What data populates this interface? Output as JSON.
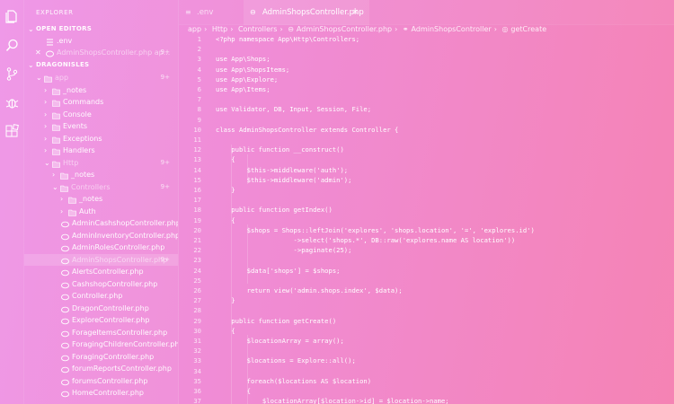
{
  "activity_bar": {
    "icons": [
      "files-icon",
      "search-icon",
      "source-control-icon",
      "debug-icon",
      "extensions-icon"
    ]
  },
  "explorer": {
    "title": "EXPLORER",
    "open_editors_label": "OPEN EDITORS",
    "open_editors": [
      {
        "name": ".env",
        "badge": ""
      },
      {
        "name": "AdminShopsController.php ap...",
        "badge": "9+"
      }
    ],
    "project_label": "DRAGONISLES",
    "tree": [
      {
        "name": "app",
        "type": "folder",
        "badge": "9+"
      },
      {
        "name": "_notes",
        "type": "folder",
        "badge": ""
      },
      {
        "name": "Commands",
        "type": "folder",
        "badge": ""
      },
      {
        "name": "Console",
        "type": "folder",
        "badge": ""
      },
      {
        "name": "Events",
        "type": "folder",
        "badge": ""
      },
      {
        "name": "Exceptions",
        "type": "folder",
        "badge": ""
      },
      {
        "name": "Handlers",
        "type": "folder",
        "badge": ""
      },
      {
        "name": "Http",
        "type": "folder",
        "badge": "9+"
      },
      {
        "name": "_notes",
        "type": "folder",
        "badge": ""
      },
      {
        "name": "Controllers",
        "type": "folder",
        "badge": "9+"
      },
      {
        "name": "_notes",
        "type": "folder",
        "badge": ""
      },
      {
        "name": "Auth",
        "type": "folder",
        "badge": ""
      },
      {
        "name": "AdminCashshopController.php",
        "type": "file",
        "badge": ""
      },
      {
        "name": "AdminInventoryController.php",
        "type": "file",
        "badge": ""
      },
      {
        "name": "AdminRolesController.php",
        "type": "file",
        "badge": ""
      },
      {
        "name": "AdminShopsController.php",
        "type": "file",
        "badge": "9+"
      },
      {
        "name": "AlertsController.php",
        "type": "file",
        "badge": ""
      },
      {
        "name": "CashshopController.php",
        "type": "file",
        "badge": ""
      },
      {
        "name": "Controller.php",
        "type": "file",
        "badge": ""
      },
      {
        "name": "DragonController.php",
        "type": "file",
        "badge": ""
      },
      {
        "name": "ExploreController.php",
        "type": "file",
        "badge": ""
      },
      {
        "name": "ForageItemsController.php",
        "type": "file",
        "badge": ""
      },
      {
        "name": "ForagingChildrenController.php",
        "type": "file",
        "badge": ""
      },
      {
        "name": "ForagingController.php",
        "type": "file",
        "badge": ""
      },
      {
        "name": "forumReportsController.php",
        "type": "file",
        "badge": ""
      },
      {
        "name": "forumsController.php",
        "type": "file",
        "badge": ""
      },
      {
        "name": "HomeController.php",
        "type": "file",
        "badge": ""
      }
    ]
  },
  "tabs": [
    {
      "name": ".env"
    },
    {
      "name": "AdminShopsController.php"
    }
  ],
  "breadcrumb": [
    "app",
    "Http",
    "Controllers",
    "AdminShopsController.php",
    "AdminShopsController",
    "getCreate"
  ],
  "editor": {
    "line_numbers": [
      "1",
      "2",
      "3",
      "4",
      "5",
      "6",
      "7",
      "8",
      "9",
      "10",
      "11",
      "12",
      "13",
      "14",
      "15",
      "16",
      "17",
      "18",
      "19",
      "20",
      "21",
      "22",
      "23",
      "24",
      "25",
      "26",
      "27",
      "28",
      "29",
      "30",
      "31",
      "32",
      "33",
      "34",
      "35",
      "36",
      "37"
    ],
    "lines": [
      "<?php namespace App\\Http\\Controllers;",
      "",
      "use App\\Shops;",
      "use App\\ShopsItems;",
      "use App\\Explore;",
      "use App\\Items;",
      "",
      "use Validator, DB, Input, Session, File;",
      "",
      "class AdminShopsController extends Controller {",
      "",
      "    public function __construct()",
      "    {",
      "        $this->middleware('auth');",
      "        $this->middleware('admin');",
      "    }",
      "",
      "    public function getIndex()",
      "    {",
      "        $shops = Shops::leftJoin('explores', 'shops.location', '=', 'explores.id')",
      "                    ->select('shops.*', DB::raw('explores.name AS location'))",
      "                    ->paginate(25);",
      "",
      "        $data['shops'] = $shops;",
      "",
      "        return view('admin.shops.index', $data);",
      "    }",
      "",
      "    public function getCreate()",
      "    {",
      "        $locationArray = array();",
      "",
      "        $locations = Explore::all();",
      "",
      "        foreach($locations AS $location)",
      "        {",
      "            $locationArray[$location->id] = $location->name;"
    ]
  }
}
